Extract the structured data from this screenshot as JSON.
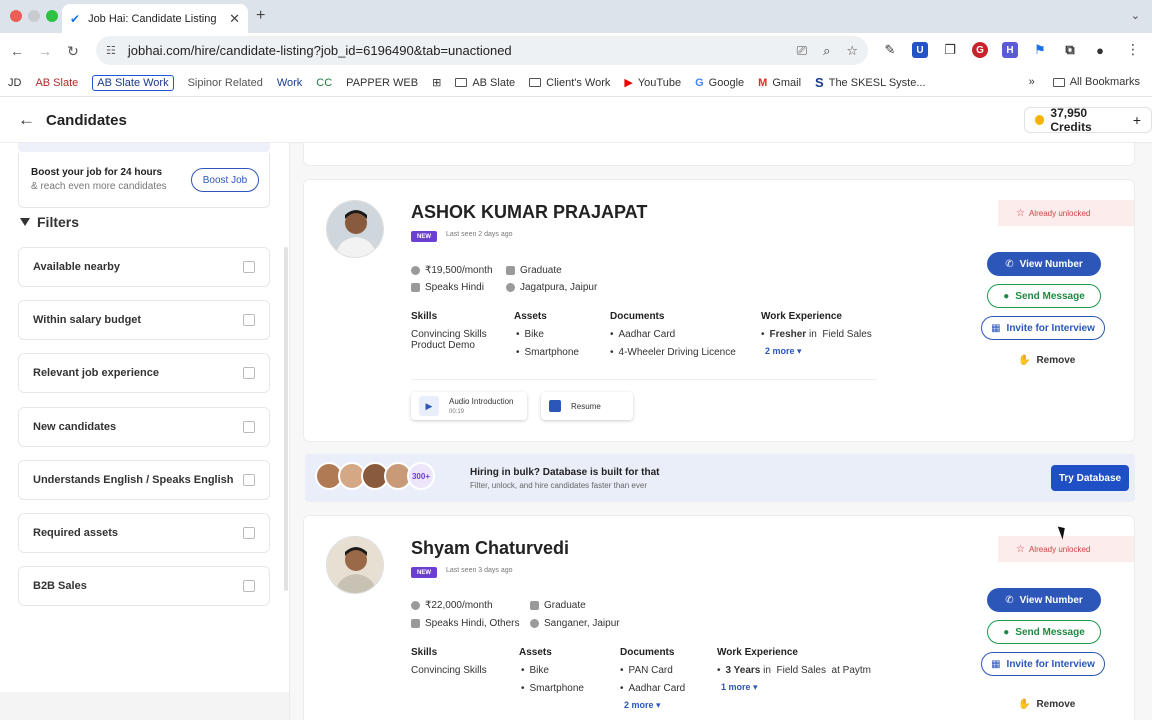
{
  "browser": {
    "tab_title": "Job Hai: Candidate Listing",
    "url": "jobhai.com/hire/candidate-listing?job_id=6196490&tab=unactioned",
    "bookmarks": [
      "JD",
      "AB Slate",
      "AB Slate Work",
      "Sipinor Related",
      "Work",
      "CC",
      "PAPPER WEB",
      "AB Slate",
      "Client's Work",
      "YouTube",
      "Google",
      "Gmail",
      "The SKESL Syste..."
    ],
    "all_bookmarks": "All Bookmarks"
  },
  "header": {
    "title": "Candidates",
    "credits": "37,950 Credits"
  },
  "sidebar": {
    "boost_title": "Boost your job for 24 hours",
    "boost_sub": "& reach even more candidates",
    "boost_button": "Boost Job",
    "filters_title": "Filters",
    "filters": [
      "Available nearby",
      "Within salary budget",
      "Relevant job experience",
      "New candidates",
      "Understands English / Speaks English",
      "Required assets",
      "B2B Sales"
    ]
  },
  "labels": {
    "skills": "Skills",
    "assets": "Assets",
    "documents": "Documents",
    "work_experience": "Work Experience",
    "already_unlocked": "Already unlocked",
    "view_number": "View Number",
    "send_message": "Send Message",
    "invite": "Invite for Interview",
    "remove": "Remove",
    "new": "NEW",
    "in": "in",
    "at": "at",
    "audio": "Audio Introduction",
    "resume": "Resume"
  },
  "candidates": [
    {
      "name": "ASHOK KUMAR PRAJAPAT",
      "last_seen": "Last seen 2 days ago",
      "salary": "₹19,500/month",
      "education": "Graduate",
      "language": "Speaks Hindi",
      "location": "Jagatpura, Jaipur",
      "skills": [
        "Convincing Skills",
        "Product Demo"
      ],
      "assets": [
        "Bike",
        "Smartphone"
      ],
      "documents": [
        "Aadhar Card",
        "4-Wheeler Driving Licence"
      ],
      "exp_level": "Fresher",
      "exp_field": "Field Sales",
      "exp_more": "2 more",
      "audio_duration": "00:19"
    },
    {
      "name": "Shyam Chaturvedi",
      "last_seen": "Last seen 3 days ago",
      "salary": "₹22,000/month",
      "education": "Graduate",
      "language": "Speaks Hindi, Others",
      "location": "Sanganer, Jaipur",
      "skills": [
        "Convincing Skills"
      ],
      "assets": [
        "Bike",
        "Smartphone"
      ],
      "documents": [
        "PAN Card",
        "Aadhar Card"
      ],
      "documents_more": "2 more",
      "exp_level": "3 Years",
      "exp_field": "Field Sales",
      "exp_company": "Paytm",
      "exp_more": "1 more"
    }
  ],
  "banner": {
    "count": "300+",
    "title": "Hiring in bulk? Database is built for that",
    "subtitle": "Filter, unlock, and hire candidates faster than ever",
    "button": "Try Database"
  }
}
